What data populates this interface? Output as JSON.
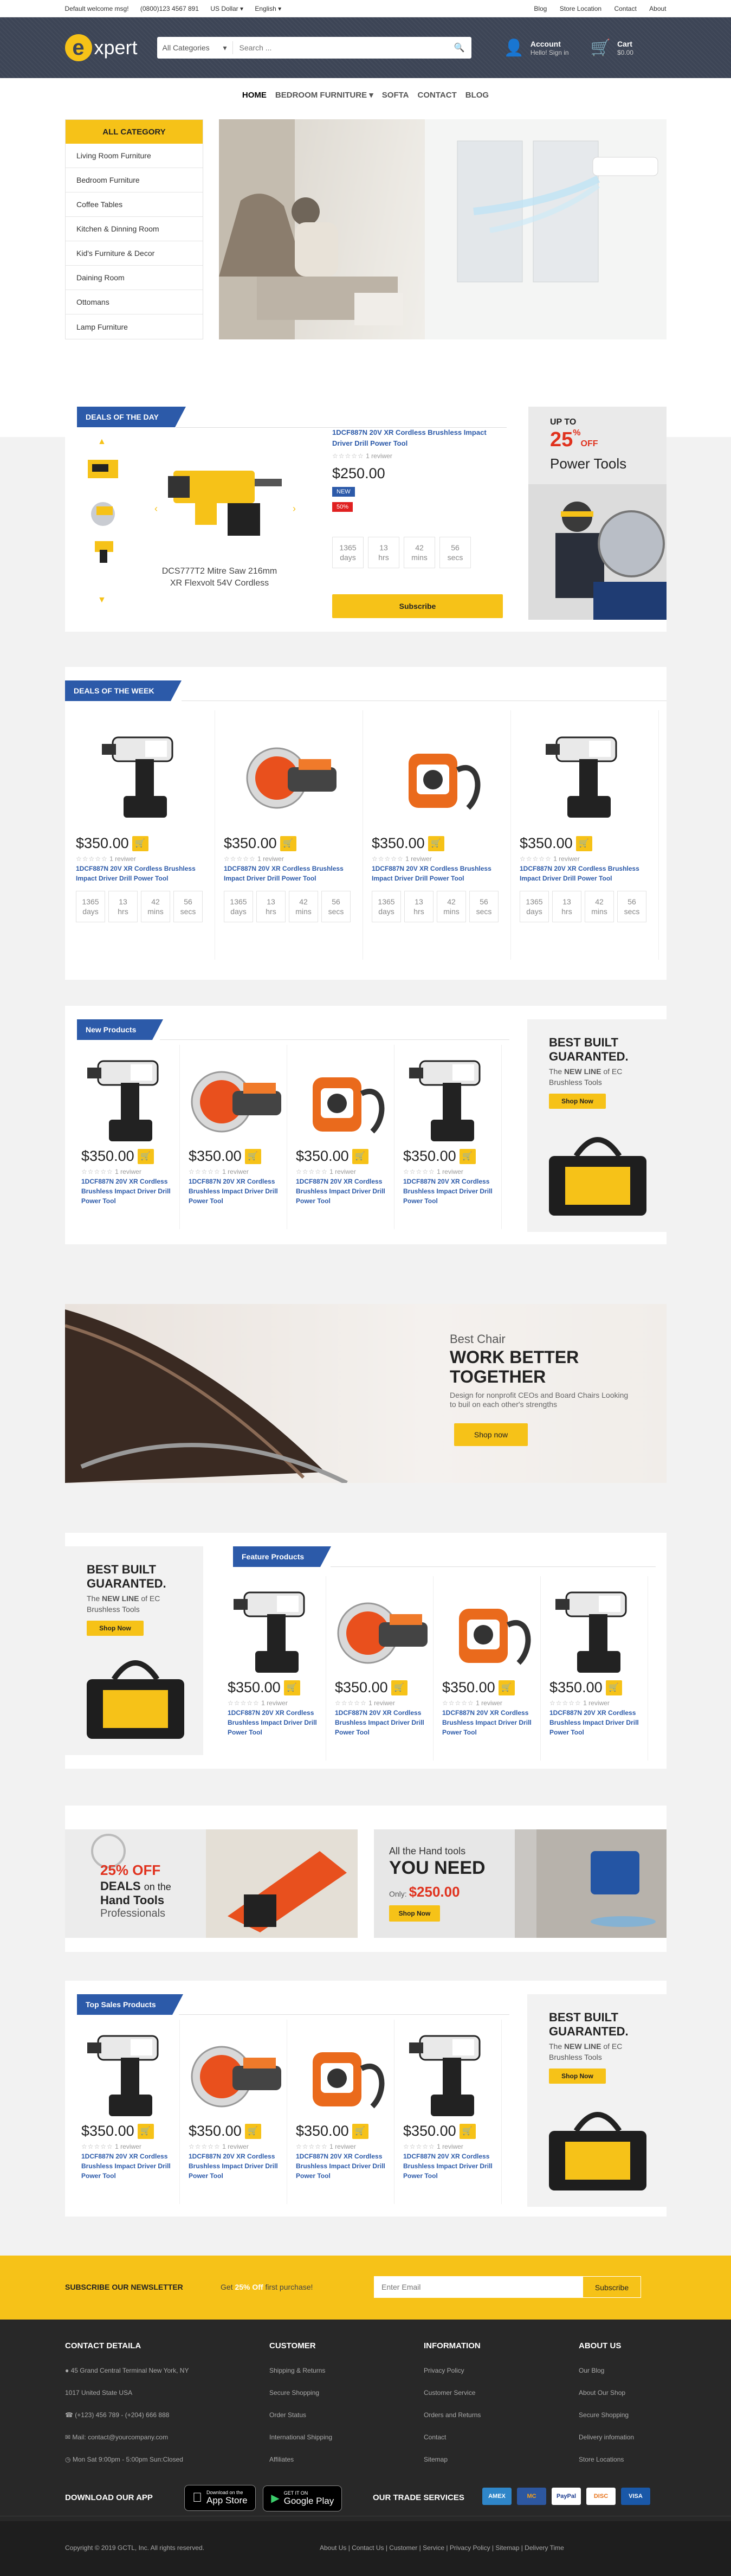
{
  "topbar": {
    "welcome": "Default welcome msg!",
    "phone": "(0800)123 4567 891",
    "currency": "US Dollar",
    "language": "English",
    "links": [
      "Blog",
      "Store Location",
      "Contact",
      "About"
    ]
  },
  "header": {
    "logo_letter": "e",
    "logo_text": "xpert",
    "search_category": "All Categories",
    "search_placeholder": "Search ...",
    "account_title": "Account",
    "account_sub": "Hello! Sign in",
    "cart_title": "Cart",
    "cart_sub": "$0.00"
  },
  "nav": [
    "HOME",
    "BEDROOM FURNITURE",
    "SOFTA",
    "CONTACT",
    "BLOG"
  ],
  "categories": {
    "title": "ALL CATEGORY",
    "items": [
      "Living Room Furniture",
      "Bedroom Furniture",
      "Coffee Tables",
      "Kitchen & Dinning Room",
      "Kid's Furniture & Decor",
      "Daining Room",
      "Ottomans",
      "Lamp Furniture"
    ]
  },
  "deal_day": {
    "title": "DEALS OF THE DAY",
    "main_caption": "DCS777T2 Mitre Saw 216mm XR Flexvolt 54V Cordless",
    "product_name": "1DCF887N 20V XR Cordless Brushless Impact Driver Drill Power Tool",
    "reviews": "1 reviwer",
    "price": "$250.00",
    "badge_new": "NEW",
    "badge_sale": "50%",
    "countdown": [
      {
        "v": "1365",
        "u": "days"
      },
      {
        "v": "13",
        "u": "hrs"
      },
      {
        "v": "42",
        "u": "mins"
      },
      {
        "v": "56",
        "u": "secs"
      }
    ],
    "subscribe": "Subscribe",
    "promo": {
      "up": "UP TO",
      "pct": "25",
      "off_sym": "%",
      "off": "OFF",
      "label": "Power Tools"
    }
  },
  "deals_week": {
    "title": "DEALS OF THE WEEK",
    "products": [
      {
        "price": "$350.00",
        "reviews": "1 reviwer",
        "name": "1DCF887N 20V XR Cordless Brushless Impact Driver Drill Power Tool",
        "img": "drill",
        "countdown": [
          {
            "v": "1365",
            "u": "days"
          },
          {
            "v": "13",
            "u": "hrs"
          },
          {
            "v": "42",
            "u": "mins"
          },
          {
            "v": "56",
            "u": "secs"
          }
        ]
      },
      {
        "price": "$350.00",
        "reviews": "1 reviwer",
        "name": "1DCF887N 20V XR Cordless Brushless Impact Driver Drill Power Tool",
        "img": "saw",
        "countdown": [
          {
            "v": "1365",
            "u": "days"
          },
          {
            "v": "13",
            "u": "hrs"
          },
          {
            "v": "42",
            "u": "mins"
          },
          {
            "v": "56",
            "u": "secs"
          }
        ]
      },
      {
        "price": "$350.00",
        "reviews": "1 reviwer",
        "name": "1DCF887N 20V XR Cordless Brushless Impact Driver Drill Power Tool",
        "img": "blower",
        "countdown": [
          {
            "v": "1365",
            "u": "days"
          },
          {
            "v": "13",
            "u": "hrs"
          },
          {
            "v": "42",
            "u": "mins"
          },
          {
            "v": "56",
            "u": "secs"
          }
        ]
      },
      {
        "price": "$350.00",
        "reviews": "1 reviwer",
        "name": "1DCF887N 20V XR Cordless Brushless Impact Driver Drill Power Tool",
        "img": "drill",
        "countdown": [
          {
            "v": "1365",
            "u": "days"
          },
          {
            "v": "13",
            "u": "hrs"
          },
          {
            "v": "42",
            "u": "mins"
          },
          {
            "v": "56",
            "u": "secs"
          }
        ]
      }
    ]
  },
  "new_products": {
    "title": "New Products",
    "products": [
      {
        "price": "$350.00",
        "reviews": "1 reviwer",
        "name": "1DCF887N 20V XR Cordless Brushless Impact Driver Drill Power Tool",
        "img": "drill"
      },
      {
        "price": "$350.00",
        "reviews": "1 reviwer",
        "name": "1DCF887N 20V XR Cordless Brushless Impact Driver Drill Power Tool",
        "img": "saw"
      },
      {
        "price": "$350.00",
        "reviews": "1 reviwer",
        "name": "1DCF887N 20V XR Cordless Brushless Impact Driver Drill Power Tool",
        "img": "blower"
      },
      {
        "price": "$350.00",
        "reviews": "1 reviwer",
        "name": "1DCF887N 20V XR Cordless Brushless Impact Driver Drill Power Tool",
        "img": "drill"
      }
    ]
  },
  "promo_guarantee": {
    "line1": "BEST BUILT",
    "line2": "GUARANTED.",
    "text_a": "The",
    "text_b": "NEW LINE",
    "text_c": "of EC Brushless Tools",
    "btn": "Shop Now"
  },
  "chair_banner": {
    "kicker": "Best Chair",
    "head1": "WORK BETTER",
    "head2": "TOGETHER",
    "sub": "Design for nonprofit CEOs and Board Chairs Looking to buil on each other's strengths",
    "btn": "Shop now"
  },
  "featured": {
    "title": "Feature Products",
    "products": [
      {
        "price": "$350.00",
        "reviews": "1 reviwer",
        "name": "1DCF887N 20V XR Cordless Brushless Impact Driver Drill Power Tool",
        "img": "drill"
      },
      {
        "price": "$350.00",
        "reviews": "1 reviwer",
        "name": "1DCF887N 20V XR Cordless Brushless Impact Driver Drill Power Tool",
        "img": "saw"
      },
      {
        "price": "$350.00",
        "reviews": "1 reviwer",
        "name": "1DCF887N 20V XR Cordless Brushless Impact Driver Drill Power Tool",
        "img": "blower"
      },
      {
        "price": "$350.00",
        "reviews": "1 reviwer",
        "name": "1DCF887N 20V XR Cordless Brushless Impact Driver Drill Power Tool",
        "img": "drill"
      }
    ]
  },
  "banner_left": {
    "pct": "25% OFF",
    "l2": "DEALS",
    "l2b": "on the",
    "l3": "Hand Tools",
    "l4": "Professionals"
  },
  "banner_right": {
    "l1": "All the Hand tools",
    "l2": "YOU NEED",
    "only": "Only:",
    "price": "$250.00",
    "btn": "Shop Now"
  },
  "top_sales": {
    "title": "Top Sales Products",
    "products": [
      {
        "price": "$350.00",
        "reviews": "1 reviwer",
        "name": "1DCF887N 20V XR Cordless Brushless Impact Driver Drill Power Tool",
        "img": "drill"
      },
      {
        "price": "$350.00",
        "reviews": "1 reviwer",
        "name": "1DCF887N 20V XR Cordless Brushless Impact Driver Drill Power Tool",
        "img": "saw"
      },
      {
        "price": "$350.00",
        "reviews": "1 reviwer",
        "name": "1DCF887N 20V XR Cordless Brushless Impact Driver Drill Power Tool",
        "img": "blower"
      },
      {
        "price": "$350.00",
        "reviews": "1 reviwer",
        "name": "1DCF887N 20V XR Cordless Brushless Impact Driver Drill Power Tool",
        "img": "drill"
      }
    ]
  },
  "newsletter": {
    "title": "SUBSCRIBE OUR NEWSLETTER",
    "offer_a": "Get",
    "offer_b": "25% Off",
    "offer_c": "first purchase!",
    "placeholder": "Enter Email",
    "btn": "Subscribe"
  },
  "footer": {
    "contact": {
      "title": "CONTACT DETAILA",
      "lines": [
        "45 Grand Central Terminal New York, NY",
        "1017 United State USA",
        "(+123) 456 789 - (+204) 666 888",
        "Mail: contact@yourcompany.com",
        "Mon Sat 9:00pm - 5:00pm Sun:Closed"
      ]
    },
    "customer": {
      "title": "CUSTOMER",
      "links": [
        "Shipping & Returns",
        "Secure Shopping",
        "Order Status",
        "International Shipping",
        "Affiliates"
      ]
    },
    "information": {
      "title": "INFORMATION",
      "links": [
        "Privacy Policy",
        "Customer Service",
        "Orders and Returns",
        "Contact",
        "Sitemap"
      ]
    },
    "about": {
      "title": "ABOUT US",
      "links": [
        "Our Blog",
        "About Our Shop",
        "Secure Shopping",
        "Delivery infomation",
        "Store Locations"
      ]
    },
    "app_title": "DOWNLOAD OUR APP",
    "appstore_small": "Download on the",
    "appstore": "App Store",
    "gplay_small": "GET IT ON",
    "gplay": "Google Play",
    "trade_title": "OUR TRADE SERVICES",
    "payments": [
      "AMEX",
      "MC",
      "PayPal",
      "DISC",
      "VISA"
    ],
    "copyright": "Copyright © 2019 GCTL, Inc. All rights reserved.",
    "bottom_links": "About Us | Contact Us | Customer | Service | Privacy Policy | Sitemap | Delivery Time"
  },
  "colors": {
    "accent": "#f6c218",
    "blue": "#2c5aa9",
    "header": "#3d4556",
    "footer": "#282828"
  }
}
